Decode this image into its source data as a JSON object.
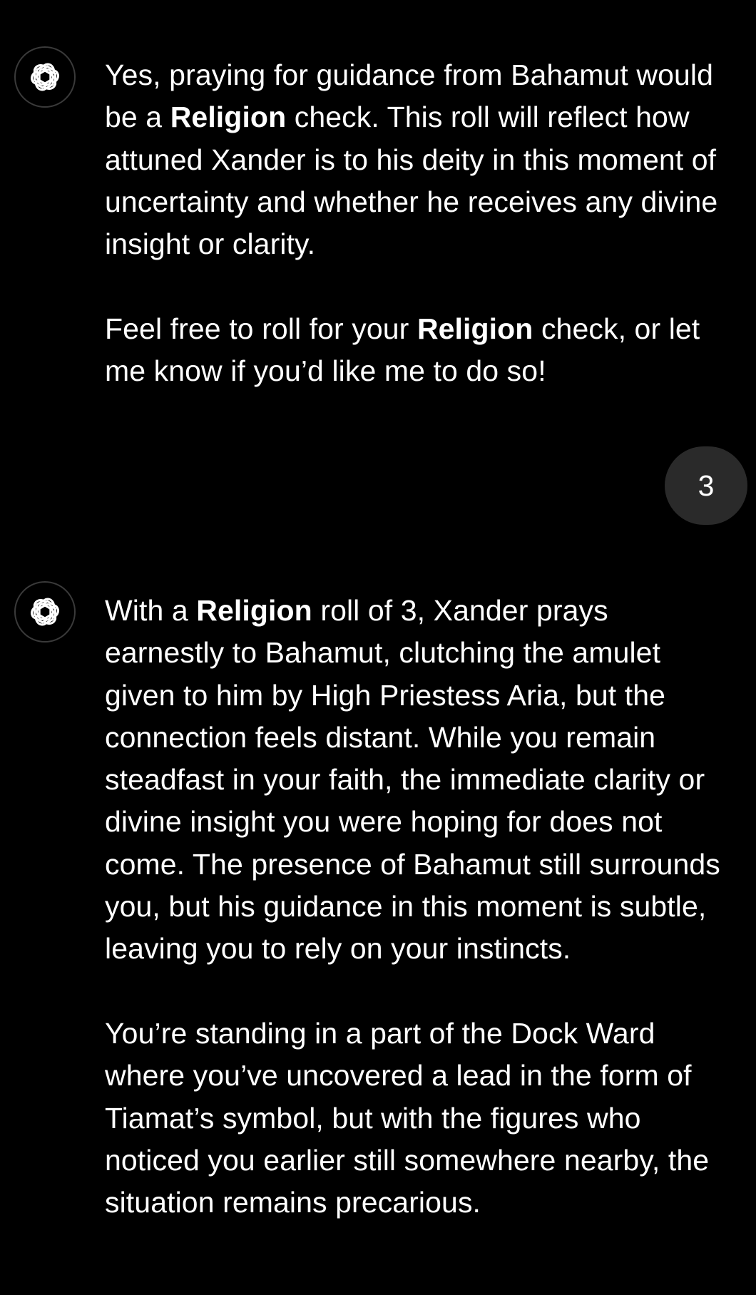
{
  "theme": {
    "background": "#000000",
    "text": "#ffffff",
    "user_bubble": "#2a2a2a",
    "avatar_border": "#3a3a3a"
  },
  "messages": [
    {
      "role": "assistant",
      "avatar_icon": "openai-logo-icon",
      "paragraphs": [
        {
          "runs": [
            {
              "text": "Yes, praying for guidance from Bahamut would be a ",
              "bold": false
            },
            {
              "text": "Religion",
              "bold": true
            },
            {
              "text": " check. This roll will reflect how attuned Xander is to his deity in this moment of uncertainty and whether he receives any divine insight or clarity.",
              "bold": false
            }
          ]
        },
        {
          "runs": [
            {
              "text": "Feel free to roll for your ",
              "bold": false
            },
            {
              "text": "Religion",
              "bold": true
            },
            {
              "text": " check, or let me know if you’d like me to do so!",
              "bold": false
            }
          ]
        }
      ]
    },
    {
      "role": "user",
      "text": "3"
    },
    {
      "role": "assistant",
      "avatar_icon": "openai-logo-icon",
      "paragraphs": [
        {
          "runs": [
            {
              "text": "With a ",
              "bold": false
            },
            {
              "text": "Religion",
              "bold": true
            },
            {
              "text": " roll of 3, Xander prays earnestly to Bahamut, clutching the amulet given to him by High Priestess Aria, but the connection feels distant. While you remain steadfast in your faith, the immediate clarity or divine insight you were hoping for does not come. The presence of Bahamut still surrounds you, but his guidance in this moment is subtle, leaving you to rely on your instincts.",
              "bold": false
            }
          ]
        },
        {
          "runs": [
            {
              "text": "You’re standing in a part of the Dock Ward where you’ve uncovered a lead in the form of Tiamat’s symbol, but with the figures who noticed you earlier still somewhere nearby, the situation remains precarious.",
              "bold": false
            }
          ]
        }
      ]
    }
  ]
}
